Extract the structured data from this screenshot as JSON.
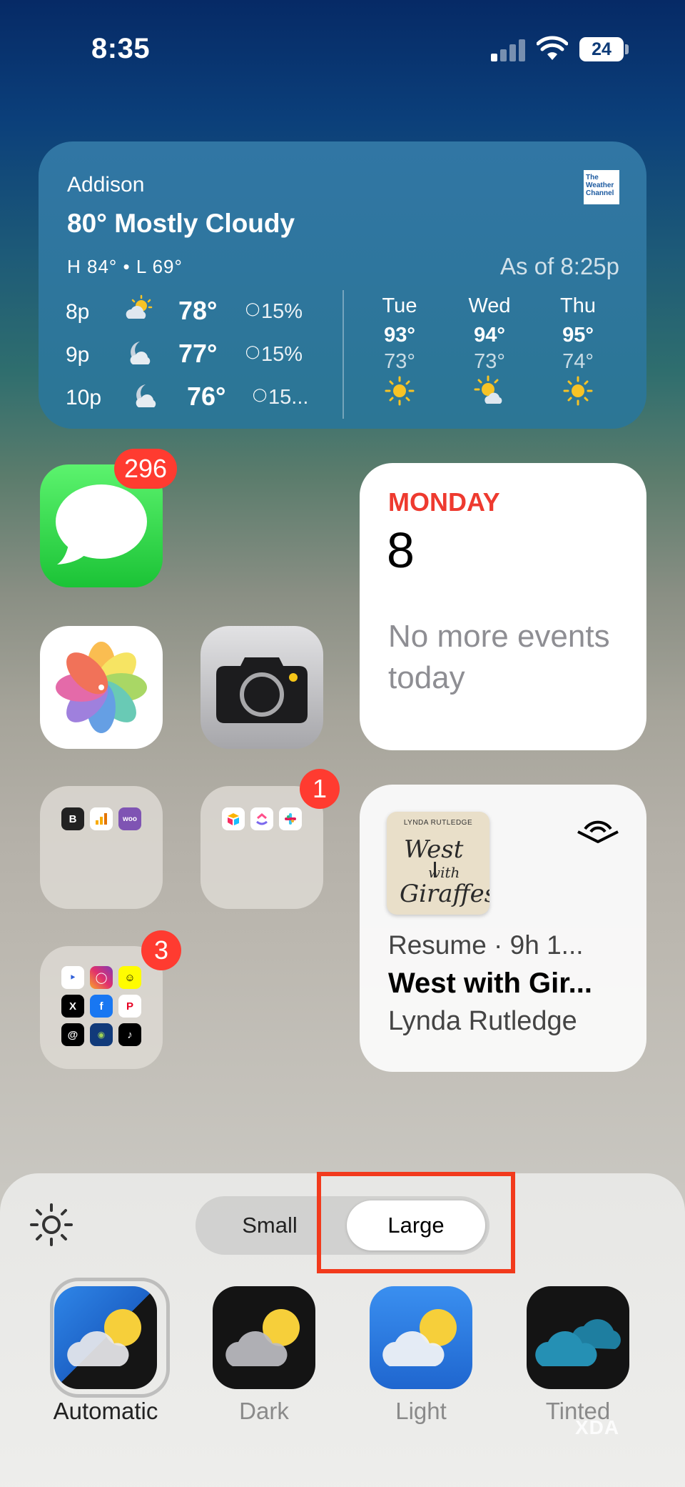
{
  "status_bar": {
    "time": "8:35",
    "battery": "24"
  },
  "weather": {
    "location": "Addison",
    "condition": "80° Mostly Cloudy",
    "hilo": "H 84° • L 69°",
    "as_of": "As of 8:25p",
    "logo_lines": [
      "The",
      "Weather",
      "Channel"
    ],
    "hourly": [
      {
        "time": "8p",
        "temp": "78°",
        "precip": "15%",
        "icon": "partly-cloudy-sun-icon"
      },
      {
        "time": "9p",
        "temp": "77°",
        "precip": "15%",
        "icon": "moon-cloud-icon"
      },
      {
        "time": "10p",
        "temp": "76°",
        "precip": "15...",
        "icon": "moon-cloud-icon"
      }
    ],
    "daily": [
      {
        "day": "Tue",
        "high": "93°",
        "low": "73°",
        "icon": "sun-icon"
      },
      {
        "day": "Wed",
        "high": "94°",
        "low": "73°",
        "icon": "sun-cloud-icon"
      },
      {
        "day": "Thu",
        "high": "95°",
        "low": "74°",
        "icon": "sun-icon"
      }
    ]
  },
  "apps": {
    "messages_badge": "296",
    "folder2_badge": "1",
    "folder3_badge": "3"
  },
  "calendar": {
    "weekday": "MONDAY",
    "date": "8",
    "events_text": "No more events today"
  },
  "audible": {
    "book_author_caps": "LYNDA RUTLEDGE",
    "cover_title": "West With Giraffes",
    "resume": "Resume  ·  9h 1...",
    "title": "West with Gir...",
    "author": "Lynda Rutledge"
  },
  "customize": {
    "size_small": "Small",
    "size_large": "Large",
    "selected_size": "Large",
    "styles": [
      {
        "label": "Automatic",
        "selected": true
      },
      {
        "label": "Dark",
        "selected": false
      },
      {
        "label": "Light",
        "selected": false
      },
      {
        "label": "Tinted",
        "selected": false
      }
    ]
  },
  "watermark": "XDA",
  "colors": {
    "accent_red": "#ff3b30",
    "calendar_red": "#ee3a2f",
    "highlight": "#f23a1c"
  }
}
